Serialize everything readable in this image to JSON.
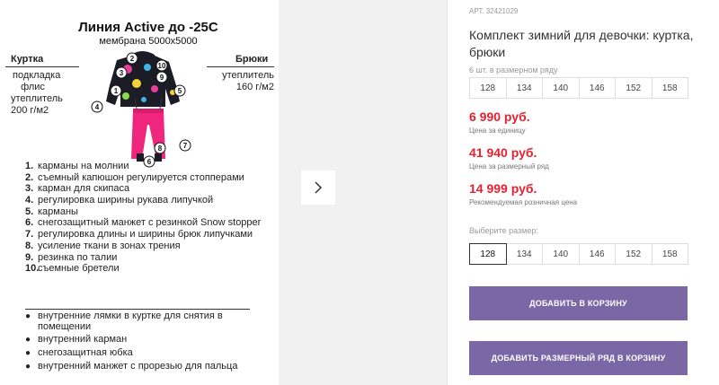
{
  "product_image": {
    "title": "Линия Active до -25С",
    "subtitle": "мембрана 5000х5000",
    "jacket": {
      "label": "Куртка",
      "lining_1": "подкладка",
      "lining_2": "флис",
      "insul_1": "утеплитель",
      "insul_2": "200 г/м2"
    },
    "pants": {
      "label": "Брюки",
      "insul_1": "утеплитель",
      "insul_2": "160 г/м2"
    },
    "callouts": [
      "1",
      "2",
      "3",
      "4",
      "5",
      "6",
      "7",
      "8",
      "9",
      "10"
    ],
    "features": [
      {
        "num": "1.",
        "text": "карманы на молнии"
      },
      {
        "num": "2.",
        "text": "съемный капюшон регулируется стопперами"
      },
      {
        "num": "3.",
        "text": "карман для скипаса"
      },
      {
        "num": "4.",
        "text": "регулировка ширины рукава липучкой"
      },
      {
        "num": "5.",
        "text": "карманы"
      },
      {
        "num": "6.",
        "text": "снегозащитный манжет с резинкой Snow stopper"
      },
      {
        "num": "7.",
        "text": "регулировка длины и ширины брюк липучками"
      },
      {
        "num": "8.",
        "text": "усиление ткани в зонах трения"
      },
      {
        "num": "9.",
        "text": "резинка по талии"
      },
      {
        "num": "10.",
        "text": "съемные бретели"
      }
    ],
    "bullets": [
      "внутренние лямки в куртке для снятия в помещении",
      "внутренний карман",
      "снегозащитная юбка",
      "внутренний манжет с прорезью для пальца"
    ]
  },
  "gallery": {
    "next_icon": "chevron-right-icon"
  },
  "product": {
    "article": "АРТ. 32421029",
    "title": "Комплект зимний для девочки: куртка, брюки",
    "row_note": "6 шт. в размерном ряду",
    "row_sizes": [
      "128",
      "134",
      "140",
      "146",
      "152",
      "158"
    ],
    "price_unit": "6 990 руб.",
    "price_unit_note": "Цена за единицу",
    "price_row": "41 940 руб.",
    "price_row_note": "Цена за размерный ряд",
    "price_retail": "14 999 руб.",
    "price_retail_note": "Рекомендуемая розничная цена",
    "choose_label": "Выберите размер:",
    "picker_sizes": [
      "128",
      "134",
      "140",
      "146",
      "152",
      "158"
    ],
    "selected_size": "128",
    "add_to_cart": "ДОБАВИТЬ В КОРЗИНУ",
    "add_row_to_cart": "ДОБАВИТЬ РАЗМЕРНЫЙ РЯД В КОРЗИНУ",
    "price_color": "#e4222f",
    "button_color": "#7b66a6"
  }
}
